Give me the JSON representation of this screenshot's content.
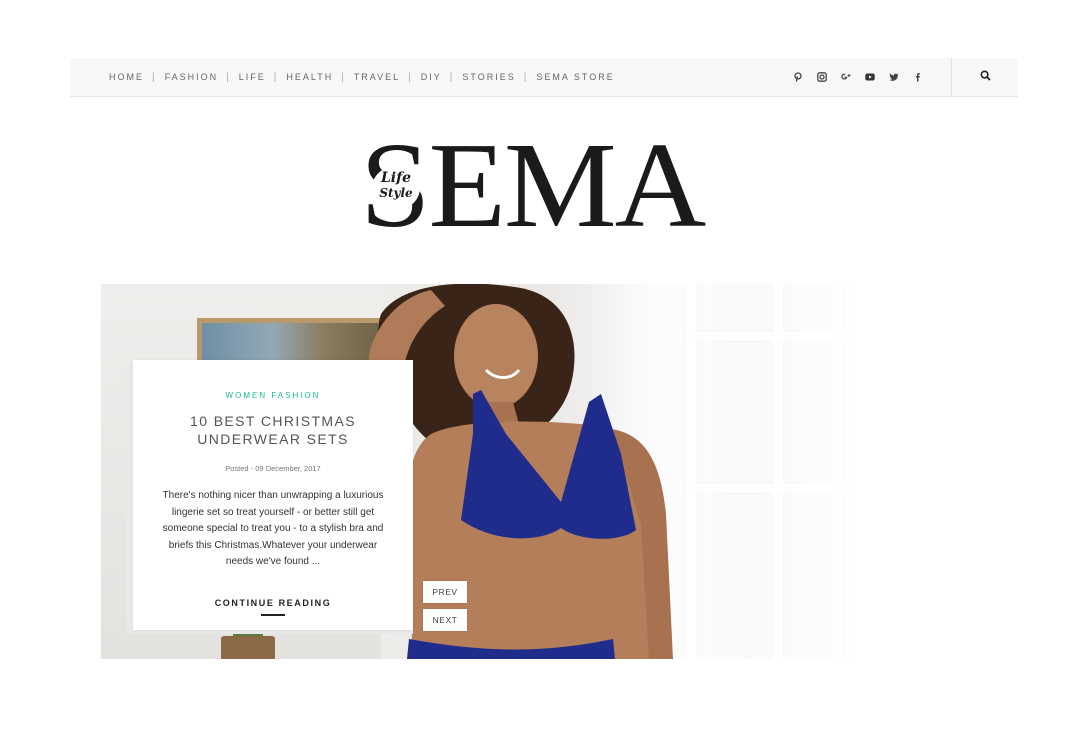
{
  "nav": {
    "items": [
      "HOME",
      "FASHION",
      "LIFE",
      "HEALTH",
      "TRAVEL",
      "DIY",
      "STORIES",
      "SEMA STORE"
    ],
    "social_icons": [
      "pinterest-icon",
      "instagram-icon",
      "google-plus-icon",
      "youtube-icon",
      "twitter-icon",
      "facebook-icon"
    ],
    "search_icon": "search-icon"
  },
  "logo": {
    "wordmark": "SEMA",
    "badge_line1": "Life",
    "badge_line2": "Style"
  },
  "featured": {
    "category": "WOMEN FASHION",
    "title": "10 BEST CHRISTMAS UNDERWEAR SETS",
    "date": "Posted - 09 December, 2017",
    "excerpt": "There's nothing nicer than unwrapping a luxurious lingerie set so treat yourself - or better still get someone special to treat you - to a stylish bra and briefs this Christmas.Whatever your underwear needs we've found ...",
    "read_more": "CONTINUE READING"
  },
  "slider": {
    "prev_label": "PREV",
    "next_label": "NEXT"
  },
  "colors": {
    "accent": "#1bbc9b",
    "nav_bg": "#f7f7f7",
    "text_dark": "#222222",
    "garment": "#1f2c8c"
  }
}
